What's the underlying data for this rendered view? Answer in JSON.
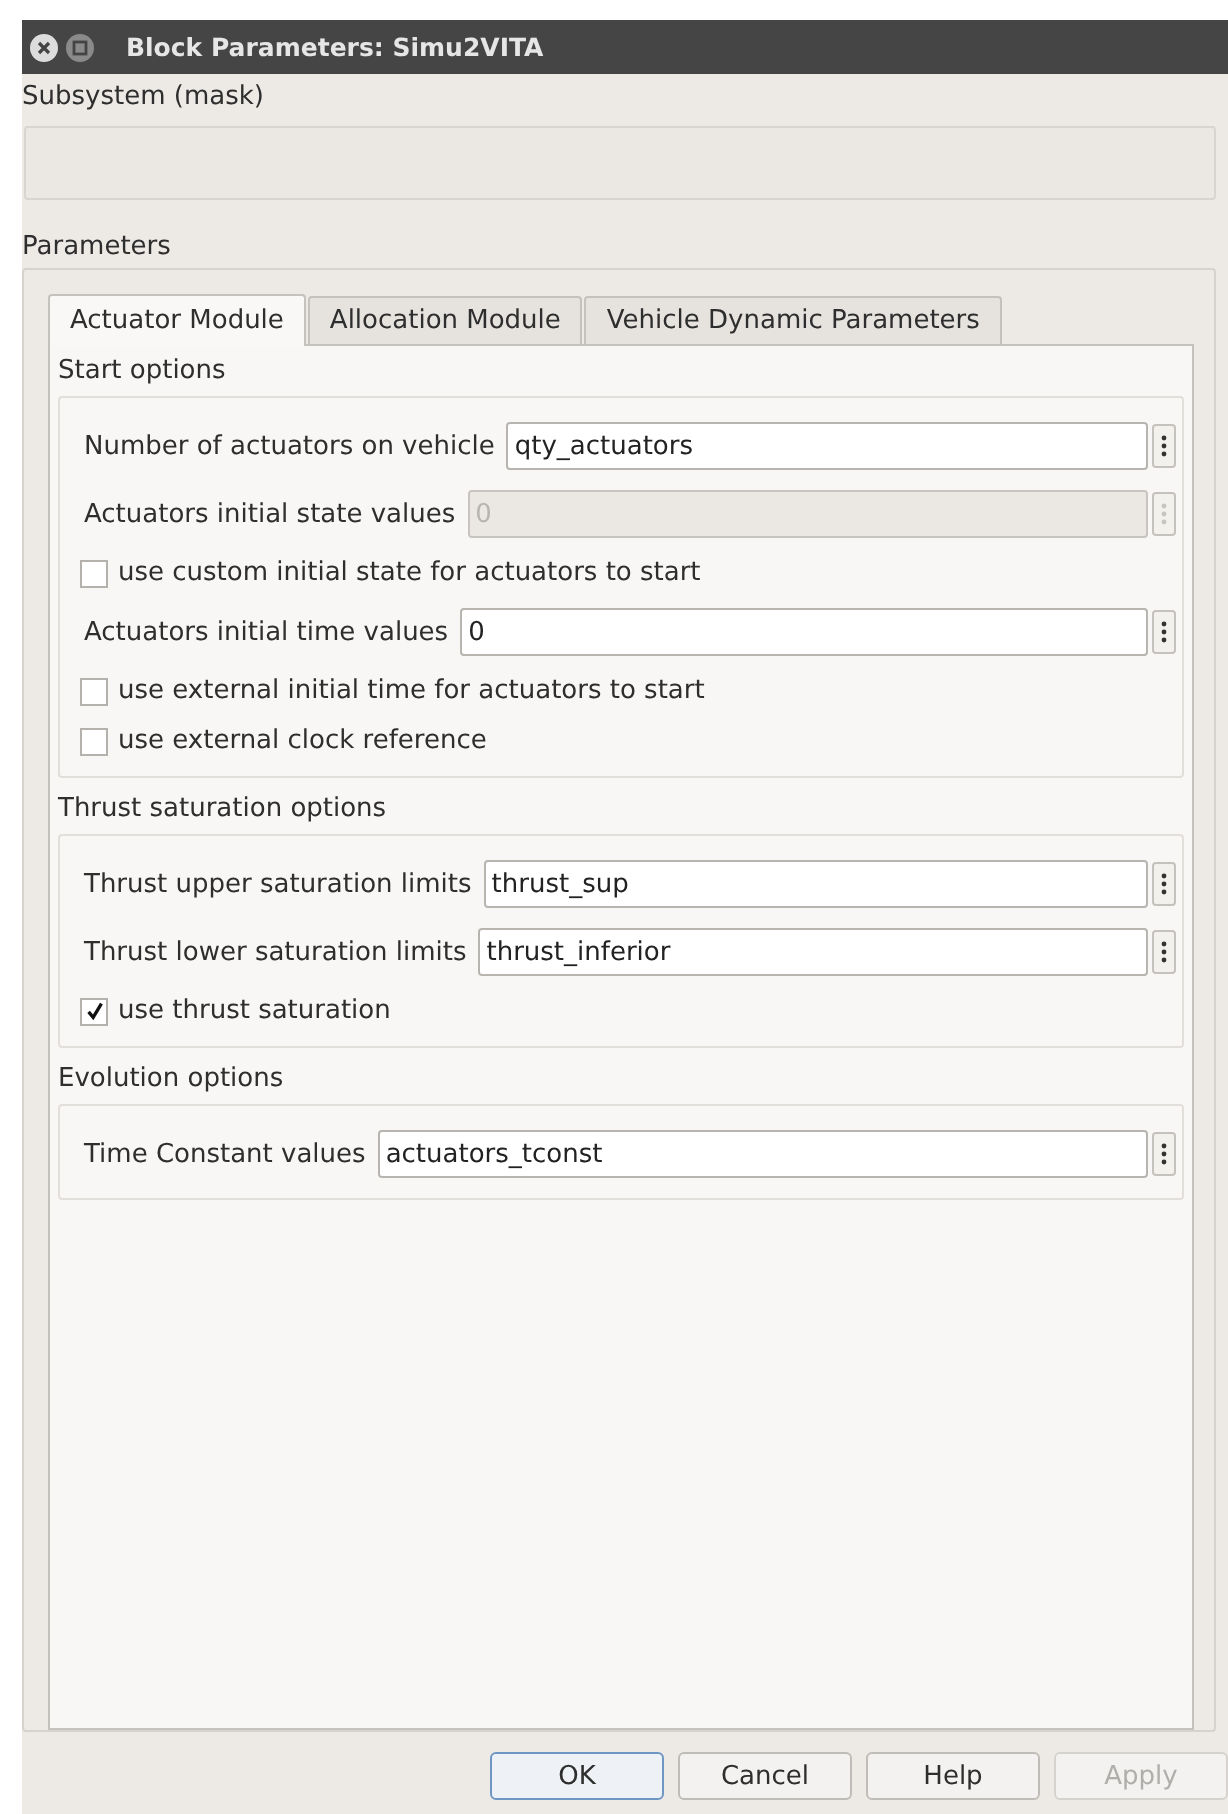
{
  "window": {
    "title": "Block Parameters: Simu2VITA"
  },
  "description": {
    "label": "Subsystem (mask)"
  },
  "parameters": {
    "label": "Parameters",
    "tabs": [
      {
        "label": "Actuator Module",
        "selected": true
      },
      {
        "label": "Allocation Module",
        "selected": false
      },
      {
        "label": "Vehicle Dynamic Parameters",
        "selected": false
      }
    ],
    "groups": [
      {
        "title": "Start options",
        "rows": [
          {
            "kind": "field",
            "label": "Number of actuators on vehicle",
            "value": "qty_actuators",
            "disabled": false
          },
          {
            "kind": "field",
            "label": "Actuators initial state values",
            "value": "0",
            "disabled": true
          },
          {
            "kind": "checkbox",
            "label": "use custom initial state for actuators to start",
            "checked": false
          },
          {
            "kind": "field",
            "label": "Actuators initial time values",
            "value": "0",
            "disabled": false
          },
          {
            "kind": "checkbox",
            "label": "use external initial time for actuators to start",
            "checked": false
          },
          {
            "kind": "checkbox",
            "label": "use external clock reference",
            "checked": false
          }
        ]
      },
      {
        "title": "Thrust saturation options",
        "rows": [
          {
            "kind": "field",
            "label": "Thrust upper saturation limits",
            "value": "thrust_sup",
            "disabled": false
          },
          {
            "kind": "field",
            "label": "Thrust lower saturation limits",
            "value": "thrust_inferior",
            "disabled": false
          },
          {
            "kind": "checkbox",
            "label": "use thrust saturation",
            "checked": true
          }
        ]
      },
      {
        "title": "Evolution options",
        "rows": [
          {
            "kind": "field",
            "label": "Time Constant values",
            "value": "actuators_tconst",
            "disabled": false
          }
        ]
      }
    ]
  },
  "buttons": [
    {
      "label": "OK",
      "disabled": false,
      "default": true
    },
    {
      "label": "Cancel",
      "disabled": false,
      "default": false
    },
    {
      "label": "Help",
      "disabled": false,
      "default": false
    },
    {
      "label": "Apply",
      "disabled": true,
      "default": false
    }
  ]
}
